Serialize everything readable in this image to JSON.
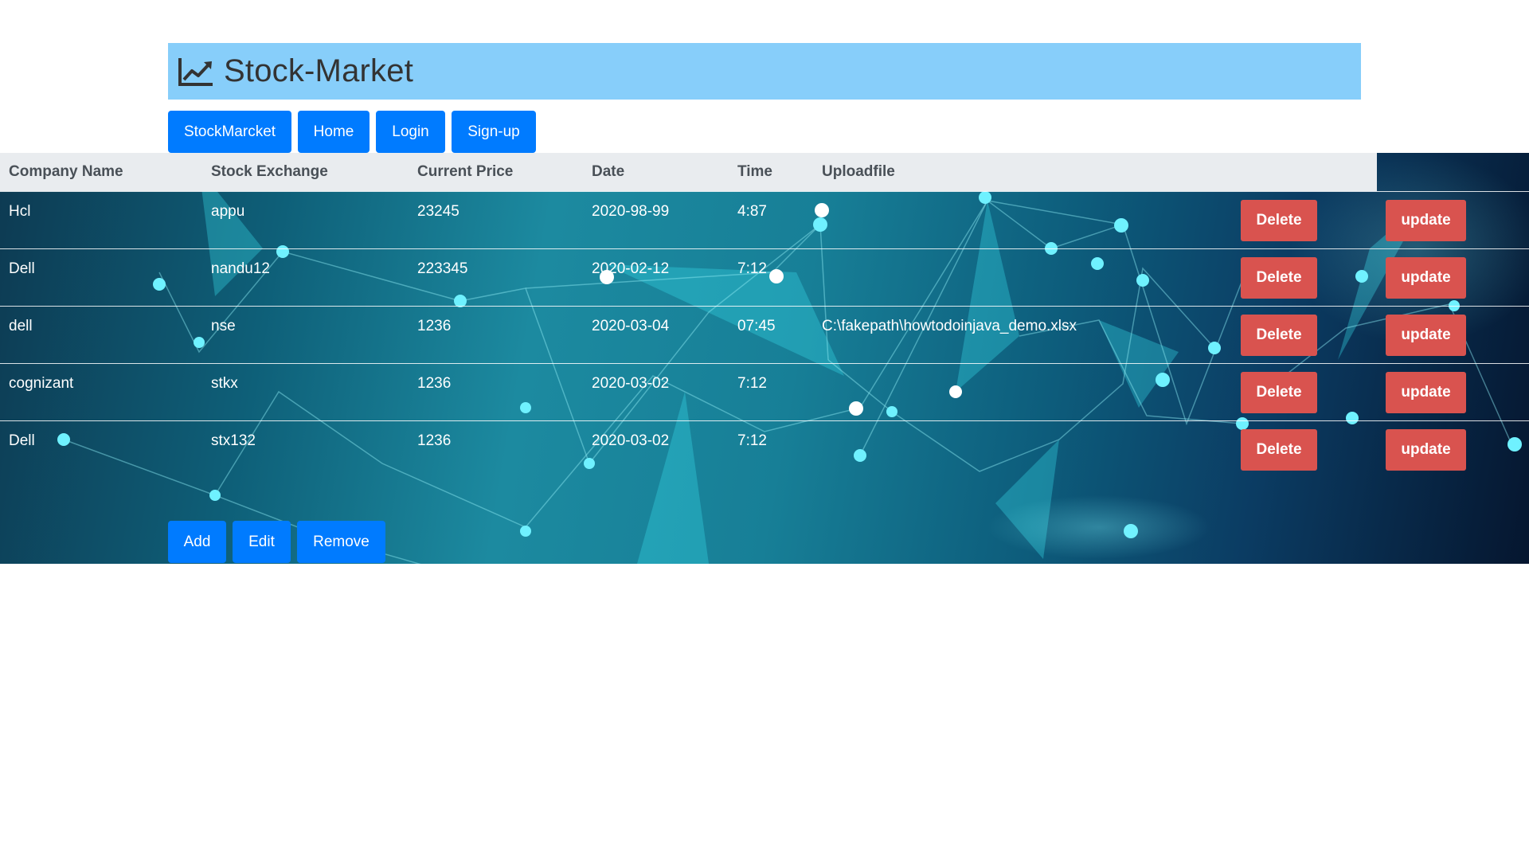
{
  "header": {
    "title": "Stock-Market",
    "logo_icon": "chart-line-icon"
  },
  "nav": {
    "items": [
      "StockMarcket",
      "Home",
      "Login",
      "Sign-up"
    ]
  },
  "table": {
    "columns": [
      "Company Name",
      "Stock Exchange",
      "Current Price",
      "Date",
      "Time",
      "Uploadfile"
    ],
    "rows": [
      {
        "company": "Hcl",
        "exchange": "appu",
        "price": "23245",
        "date": "2020-98-99",
        "time": "4:87",
        "file": "",
        "delete_label": "Delete",
        "update_label": "update"
      },
      {
        "company": "Dell",
        "exchange": "nandu12",
        "price": "223345",
        "date": "2020-02-12",
        "time": "7:12",
        "file": "",
        "delete_label": "Delete",
        "update_label": "update"
      },
      {
        "company": "dell",
        "exchange": "nse",
        "price": "1236",
        "date": "2020-03-04",
        "time": "07:45",
        "file": "C:\\fakepath\\howtodoinjava_demo.xlsx",
        "delete_label": "Delete",
        "update_label": "update"
      },
      {
        "company": "cognizant",
        "exchange": "stkx",
        "price": "1236",
        "date": "2020-03-02",
        "time": "7:12",
        "file": "",
        "delete_label": "Delete",
        "update_label": "update"
      },
      {
        "company": "Dell",
        "exchange": "stx132",
        "price": "1236",
        "date": "2020-03-02",
        "time": "7:12",
        "file": "",
        "delete_label": "Delete",
        "update_label": "update"
      }
    ]
  },
  "actions": {
    "add": "Add",
    "edit": "Edit",
    "remove": "Remove"
  },
  "colors": {
    "header_bg": "#87cefa",
    "primary_button": "#007bff",
    "danger_button": "#d9534f",
    "table_head_bg": "#e9ecef"
  }
}
